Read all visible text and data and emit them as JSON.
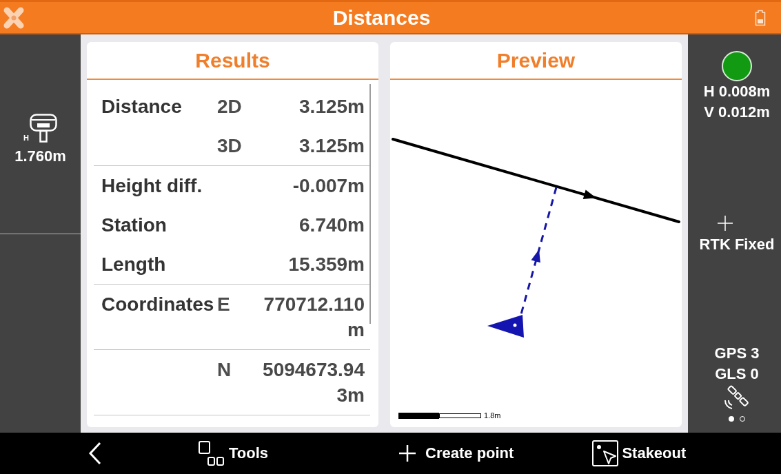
{
  "app_bar": {
    "title": "Distances"
  },
  "antenna": {
    "height_label": "H",
    "height": "1.760m"
  },
  "results": {
    "title": "Results",
    "groups": [
      {
        "rows": [
          {
            "label": "Distance",
            "component": "2D",
            "value": "3.125m"
          },
          {
            "component": "3D",
            "value": "3.125m"
          }
        ]
      },
      {
        "rows": [
          {
            "label": "Height diff.",
            "value": "-0.007m"
          },
          {
            "label": "Station",
            "value": "6.740m"
          },
          {
            "label": "Length",
            "value": "15.359m"
          }
        ]
      },
      {
        "rows": [
          {
            "label": "Coordinates",
            "component": "E",
            "value": "770712.110m"
          }
        ]
      },
      {
        "rows": [
          {
            "component": "N",
            "value": "5094673.943m"
          }
        ]
      }
    ]
  },
  "preview": {
    "title": "Preview",
    "scale_label": "1.8m"
  },
  "status_panel": {
    "precision_h": "H 0.008m",
    "precision_v": "V 0.012m",
    "solution": "RTK Fixed",
    "gps": "GPS 3",
    "glonass": "GLS 0",
    "page_dots": [
      {
        "selected": true
      },
      {
        "selected": false
      }
    ]
  },
  "bottom_bar": {
    "actions": [
      {
        "kind": "back"
      },
      {
        "kind": "tools",
        "label": "Tools"
      },
      {
        "kind": "create_point",
        "label": "Create point"
      },
      {
        "kind": "stakeout",
        "label": "Stakeout"
      }
    ]
  }
}
